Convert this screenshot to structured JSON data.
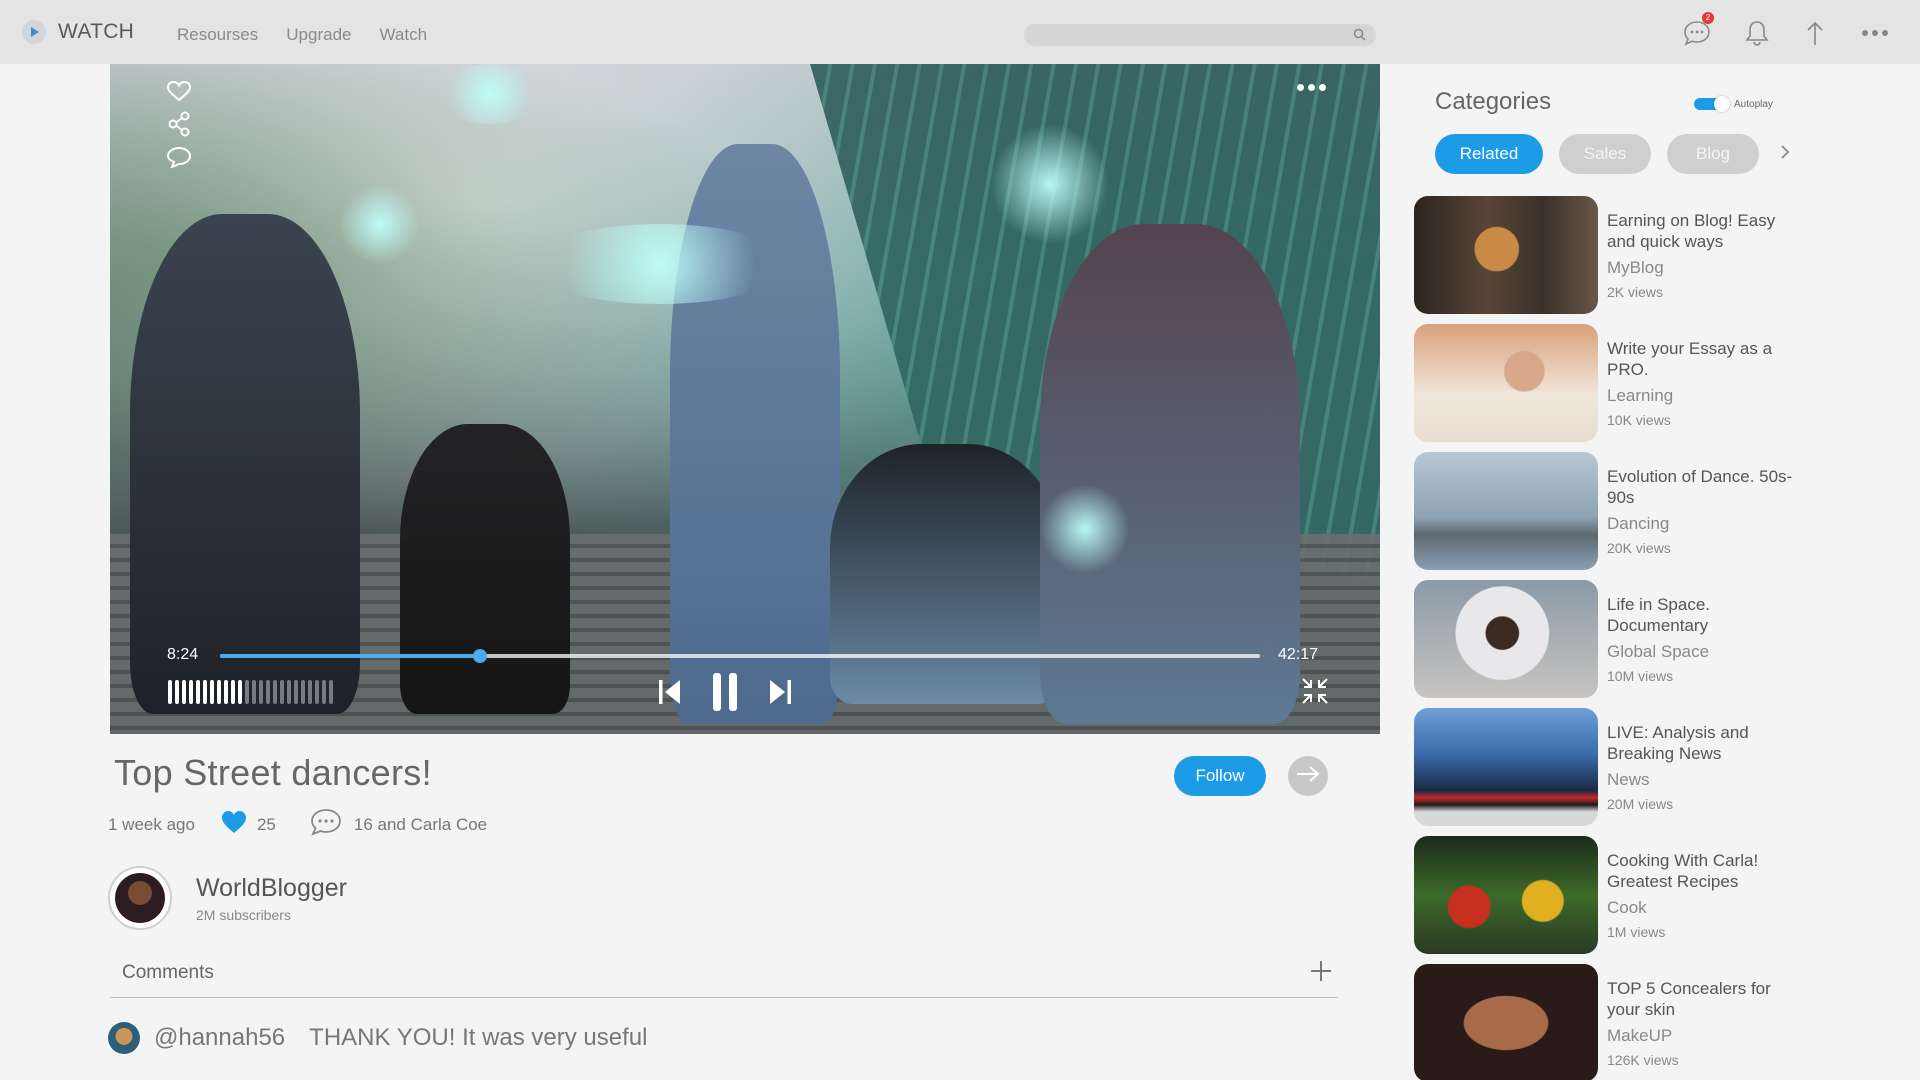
{
  "app": {
    "name": "WATCH"
  },
  "nav": {
    "items": [
      "Resourses",
      "Upgrade",
      "Watch"
    ]
  },
  "topbar": {
    "notification_count": "2"
  },
  "player": {
    "current_time": "8:24",
    "total_time": "42:17",
    "progress": 0.25,
    "volume_level": 0.45
  },
  "video": {
    "title": "Top Street dancers!",
    "posted": "1 week ago",
    "likes": "25",
    "comments_summary": "16 and Carla Coe",
    "follow_label": "Follow"
  },
  "channel": {
    "name": "WorldBlogger",
    "subscribers": "2M subscribers"
  },
  "comments": {
    "header": "Comments",
    "items": [
      {
        "user": "@hannah56",
        "text": "THANK YOU! It was very useful"
      }
    ]
  },
  "sidebar": {
    "title": "Categories",
    "autoplay_label": "Autoplay",
    "autoplay_on": true,
    "chips": [
      "Related",
      "Sales",
      "Blog"
    ],
    "related": [
      {
        "title": "Earning on Blog! Easy and quick ways",
        "channel": "MyBlog",
        "views": "2K views"
      },
      {
        "title": "Write your Essay as a PRO.",
        "channel": "Learning",
        "views": "10K views"
      },
      {
        "title": "Evolution of Dance. 50s-90s",
        "channel": "Dancing",
        "views": "20K views"
      },
      {
        "title": "Life in Space. Documentary",
        "channel": "Global Space",
        "views": "10M views"
      },
      {
        "title": "LIVE: Analysis and Breaking News",
        "channel": "News",
        "views": "20M views"
      },
      {
        "title": "Cooking With Carla! Greatest Recipes",
        "channel": "Cook",
        "views": "1M views"
      },
      {
        "title": "TOP 5 Concealers for your skin",
        "channel": "MakeUP",
        "views": "126K views"
      }
    ]
  },
  "colors": {
    "accent": "#1c9ce6",
    "progress": "#4fa9ea",
    "badge": "#e53935"
  },
  "icons": [
    "play-logo-icon",
    "search-icon",
    "chat-icon",
    "bell-icon",
    "upload-arrow-icon",
    "more-icon",
    "heart-icon",
    "share-icon",
    "comment-icon",
    "previous-icon",
    "pause-icon",
    "next-icon",
    "collapse-icon",
    "arrow-right-icon",
    "plus-icon",
    "chevron-right-icon"
  ]
}
